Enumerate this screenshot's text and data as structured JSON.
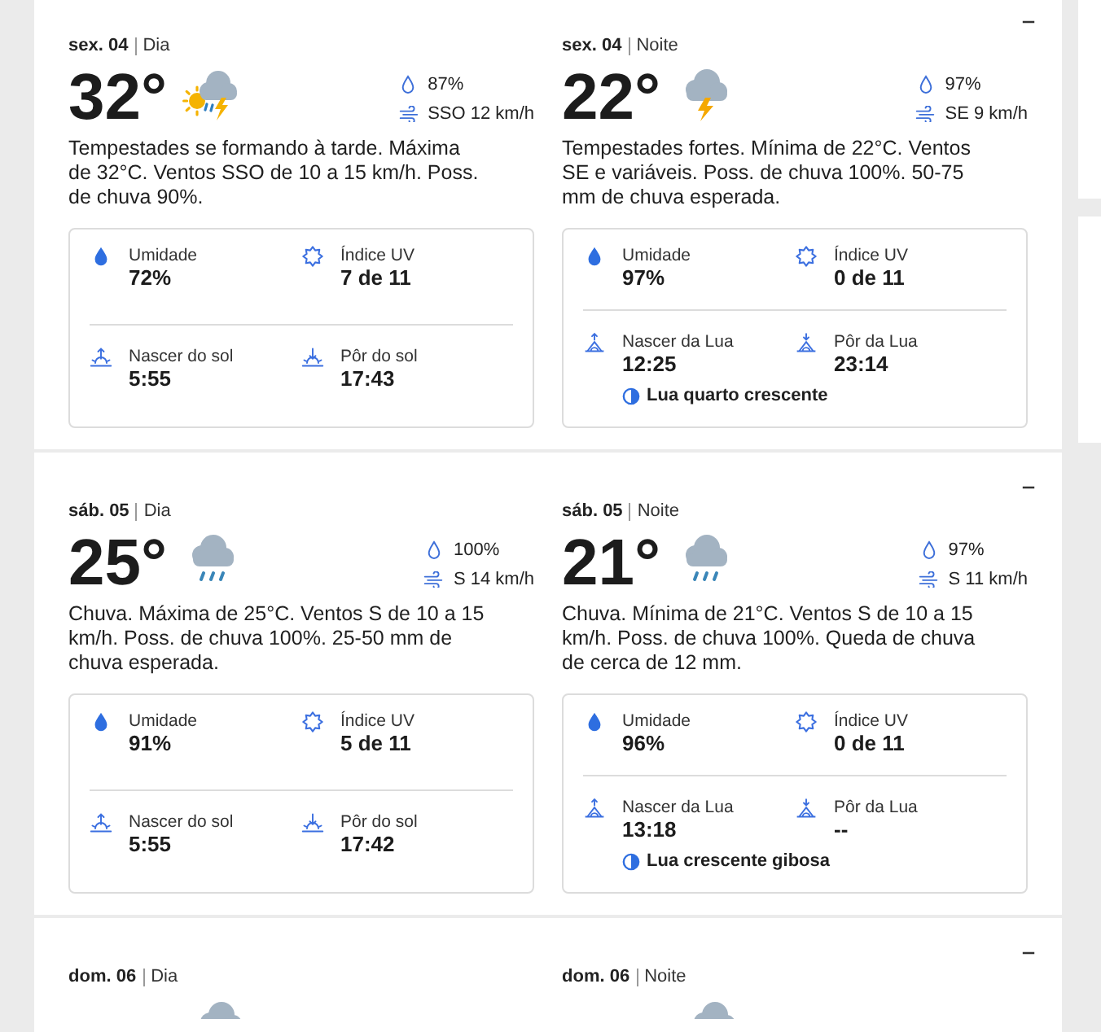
{
  "sections": [
    {
      "expanded": true,
      "periods": [
        {
          "date": "sex. 04",
          "part": "Dia",
          "temperature": "32°",
          "kind": "sun-storm",
          "precip": "87%",
          "wind": "SSO 12 km/h",
          "description": "Tempestades se formando à tarde. Máxima de 32°C. Ventos SSO de 10 a 15 km/h. Poss. de chuva 90%.",
          "details": [
            {
              "kind": "humidity",
              "label": "Umidade",
              "value": "72%"
            },
            {
              "kind": "uv",
              "label": "Índice UV",
              "value": "7 de 11"
            },
            {
              "kind": "sunrise",
              "label": "Nascer do sol",
              "value": "5:55"
            },
            {
              "kind": "sunset",
              "label": "Pôr do sol",
              "value": "17:43"
            }
          ]
        },
        {
          "date": "sex. 04",
          "part": "Noite",
          "temperature": "22°",
          "kind": "storm",
          "precip": "97%",
          "wind": "SE 9 km/h",
          "description": "Tempestades fortes. Mínima de 22°C. Ventos SE e variáveis. Poss. de chuva 100%. 50-75 mm de chuva esperada.",
          "details": [
            {
              "kind": "humidity",
              "label": "Umidade",
              "value": "97%"
            },
            {
              "kind": "uv",
              "label": "Índice UV",
              "value": "0 de 11"
            },
            {
              "kind": "moonrise",
              "label": "Nascer da Lua",
              "value": "12:25"
            },
            {
              "kind": "moonset",
              "label": "Pôr da Lua",
              "value": "23:14"
            }
          ],
          "moon_phase": "Lua quarto crescente"
        }
      ]
    },
    {
      "expanded": true,
      "periods": [
        {
          "date": "sáb. 05",
          "part": "Dia",
          "temperature": "25°",
          "kind": "rain",
          "precip": "100%",
          "wind": "S 14 km/h",
          "description": "Chuva. Máxima de 25°C. Ventos S de 10 a 15 km/h. Poss. de chuva 100%. 25-50 mm de chuva esperada.",
          "details": [
            {
              "kind": "humidity",
              "label": "Umidade",
              "value": "91%"
            },
            {
              "kind": "uv",
              "label": "Índice UV",
              "value": "5 de 11"
            },
            {
              "kind": "sunrise",
              "label": "Nascer do sol",
              "value": "5:55"
            },
            {
              "kind": "sunset",
              "label": "Pôr do sol",
              "value": "17:42"
            }
          ]
        },
        {
          "date": "sáb. 05",
          "part": "Noite",
          "temperature": "21°",
          "kind": "rain",
          "precip": "97%",
          "wind": "S 11 km/h",
          "description": "Chuva. Mínima de 21°C. Ventos S de 10 a 15 km/h. Poss. de chuva 100%. Queda de chuva de cerca de 12 mm.",
          "details": [
            {
              "kind": "humidity",
              "label": "Umidade",
              "value": "96%"
            },
            {
              "kind": "uv",
              "label": "Índice UV",
              "value": "0 de 11"
            },
            {
              "kind": "moonrise",
              "label": "Nascer da Lua",
              "value": "13:18"
            },
            {
              "kind": "moonset",
              "label": "Pôr da Lua",
              "value": "--"
            }
          ],
          "moon_phase": "Lua crescente gibosa"
        }
      ]
    },
    {
      "expanded": true,
      "periods": [
        {
          "date": "dom. 06",
          "part": "Dia",
          "kind": "cloud"
        },
        {
          "date": "dom. 06",
          "part": "Noite",
          "kind": "cloud"
        }
      ]
    }
  ]
}
